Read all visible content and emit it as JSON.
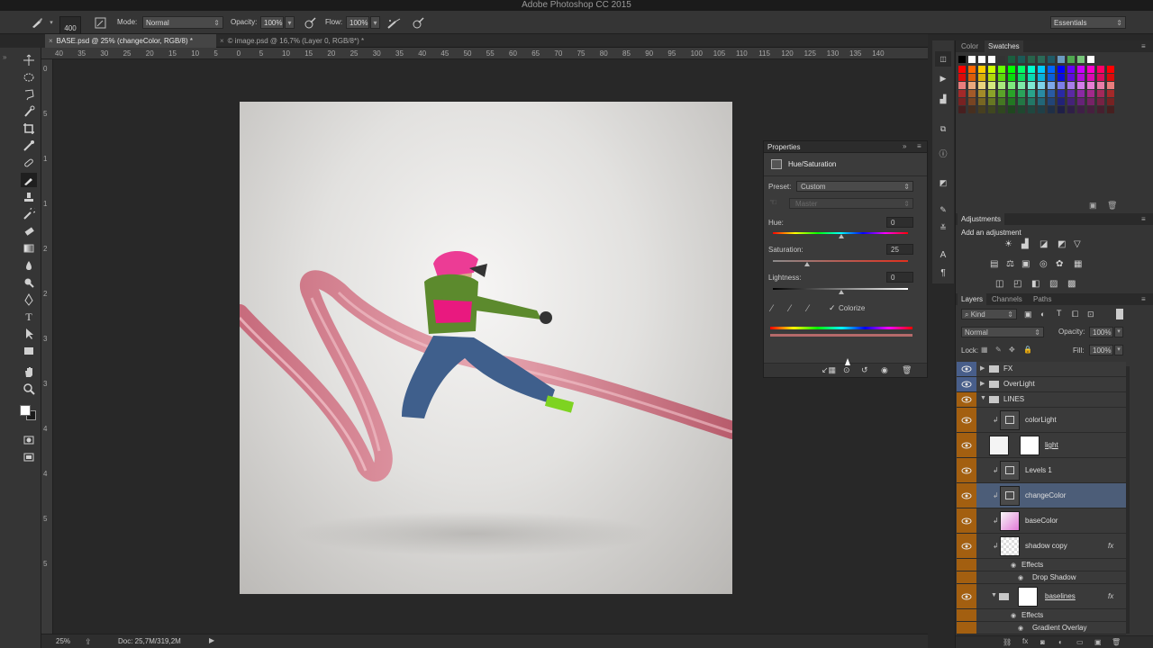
{
  "app": {
    "title": "Adobe Photoshop CC 2015"
  },
  "options": {
    "brush_size": "400",
    "mode_label": "Mode:",
    "mode_value": "Normal",
    "opacity_label": "Opacity:",
    "opacity_value": "100%",
    "flow_label": "Flow:",
    "flow_value": "100%",
    "workspace": "Essentials"
  },
  "tabs": [
    {
      "label": "BASE.psd @ 25% (changeColor, RGB/8) *",
      "active": true
    },
    {
      "label": "© image.psd @ 16,7% (Layer 0, RGB/8*) *",
      "active": false
    }
  ],
  "ruler": {
    "h_ticks": [
      "40",
      "35",
      "30",
      "25",
      "20",
      "15",
      "10",
      "5",
      "0",
      "5",
      "10",
      "15",
      "20",
      "25",
      "30",
      "35",
      "40",
      "45",
      "50",
      "55",
      "60",
      "65",
      "70",
      "75",
      "80",
      "85",
      "90",
      "95",
      "100",
      "105",
      "110",
      "115",
      "120",
      "125",
      "130",
      "135",
      "140"
    ],
    "v_ticks": [
      "0",
      "5",
      "1",
      "1",
      "2",
      "2",
      "3",
      "3",
      "4",
      "4",
      "5",
      "5"
    ]
  },
  "status": {
    "zoom": "25%",
    "doc": "Doc: 25,7M/319,2M"
  },
  "panels": {
    "color_tab": "Color",
    "swatches_tab": "Swatches",
    "adjustments_title": "Adjustments",
    "add_adjustment": "Add an adjustment",
    "layers_tab": "Layers",
    "channels_tab": "Channels",
    "paths_tab": "Paths"
  },
  "properties": {
    "title": "Properties",
    "type": "Hue/Saturation",
    "preset_label": "Preset:",
    "preset_value": "Custom",
    "channel_value": "Master",
    "hue_label": "Hue:",
    "hue_value": "0",
    "saturation_label": "Saturation:",
    "saturation_value": "25",
    "lightness_label": "Lightness:",
    "lightness_value": "0",
    "colorize_label": "Colorize",
    "colorize_checked": true
  },
  "layers_panel": {
    "kind_filter": "Kind",
    "blend_mode": "Normal",
    "opacity_label": "Opacity:",
    "opacity_value": "100%",
    "lock_label": "Lock:",
    "fill_label": "Fill:",
    "fill_value": "100%",
    "rows": [
      {
        "name": "FX",
        "type": "group"
      },
      {
        "name": "OverLight",
        "type": "group"
      },
      {
        "name": "LINES",
        "type": "group-open"
      },
      {
        "name": "colorLight",
        "type": "adjustment"
      },
      {
        "name": "light",
        "type": "masked"
      },
      {
        "name": "Levels 1",
        "type": "adjustment"
      },
      {
        "name": "changeColor",
        "type": "adjustment",
        "selected": true
      },
      {
        "name": "baseColor",
        "type": "layer"
      },
      {
        "name": "shadow copy",
        "type": "layer-fx"
      },
      {
        "name": "Effects",
        "type": "sub"
      },
      {
        "name": "Drop Shadow",
        "type": "sub2"
      },
      {
        "name": "baselines",
        "type": "group-fx"
      },
      {
        "name": "Effects",
        "type": "sub"
      },
      {
        "name": "Gradient Overlay",
        "type": "sub2"
      }
    ]
  },
  "colors": {
    "selection": "#4c5d78",
    "orange_tag": "#a35f10",
    "blue_tag": "#485e8a"
  }
}
